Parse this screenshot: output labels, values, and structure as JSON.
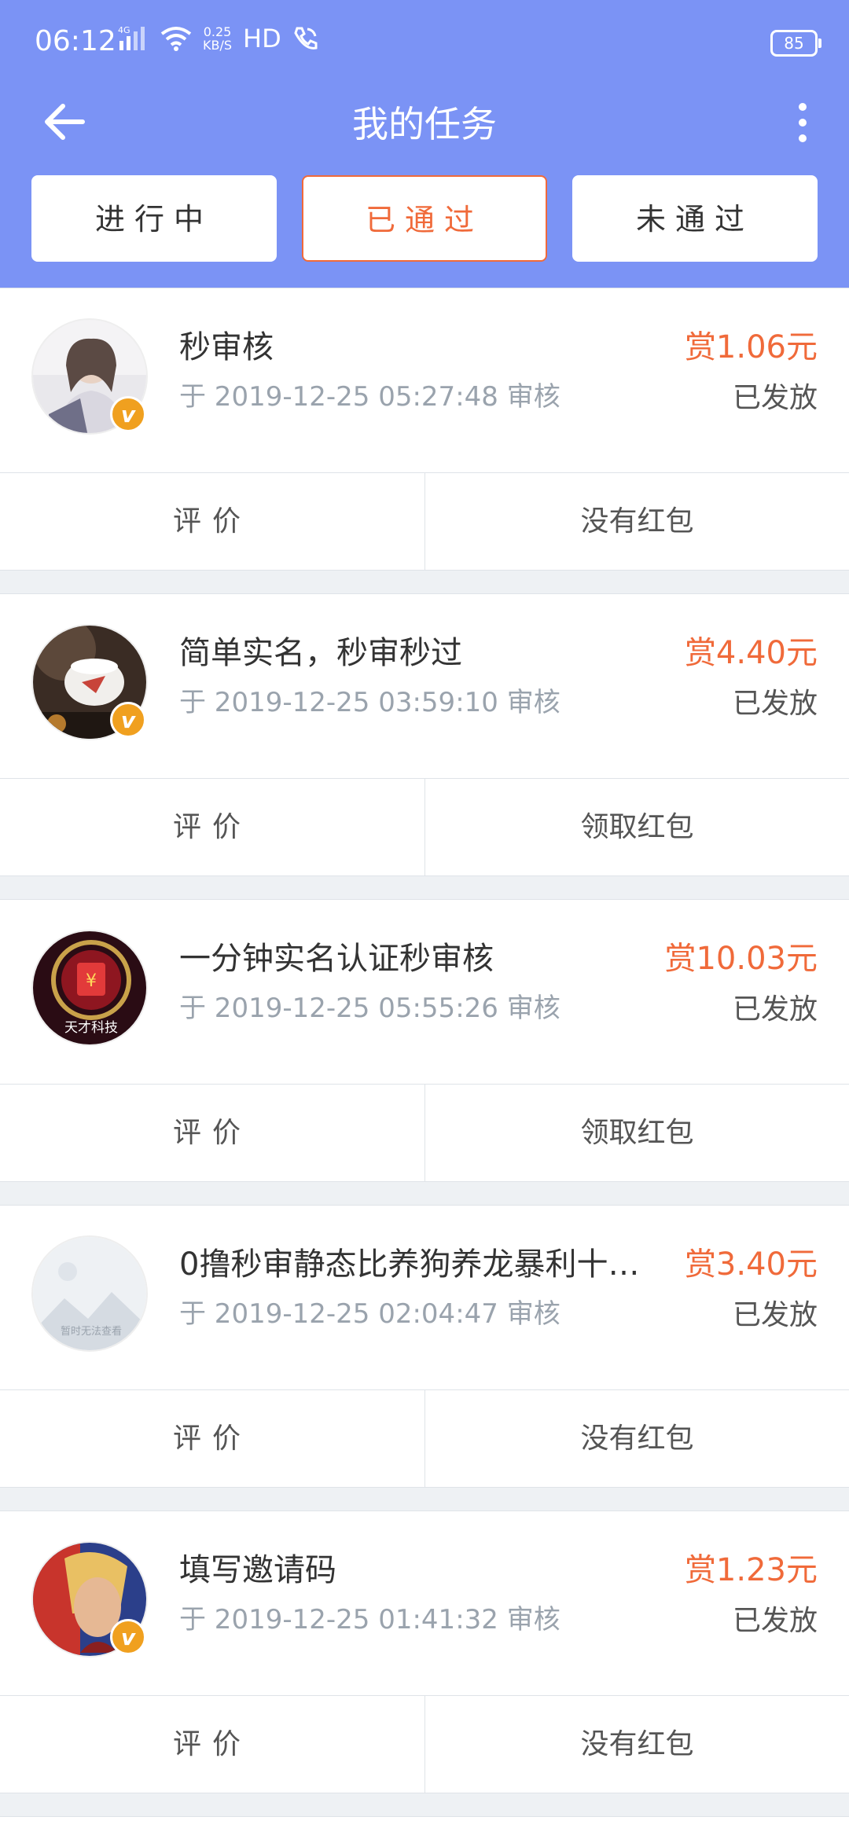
{
  "status_bar": {
    "time": "06:12",
    "net_speed_top": "0.25",
    "net_speed_bottom": "KB/S",
    "hd_label": "HD",
    "battery": "85"
  },
  "header": {
    "title": "我的任务",
    "back_icon": "arrow-left-icon",
    "menu_icon": "more-vertical-icon"
  },
  "tabs": [
    {
      "label": "进行中",
      "active": false
    },
    {
      "label": "已通过",
      "active": true
    },
    {
      "label": "未通过",
      "active": false
    }
  ],
  "colors": {
    "header_bg": "#7b93f5",
    "accent": "#f06a3a",
    "badge": "#f0a01f"
  },
  "tasks": [
    {
      "name": "秒审核",
      "time": "于 2019-12-25 05:27:48 审核",
      "reward": "赏1.06元",
      "status": "已发放",
      "rate_label": "评价",
      "packet_label": "没有红包",
      "verified": true
    },
    {
      "name": "简单实名，秒审秒过",
      "time": "于 2019-12-25 03:59:10 审核",
      "reward": "赏4.40元",
      "status": "已发放",
      "rate_label": "评价",
      "packet_label": "领取红包",
      "verified": true
    },
    {
      "name": "一分钟实名认证秒审核",
      "time": "于 2019-12-25 05:55:26 审核",
      "reward": "赏10.03元",
      "status": "已发放",
      "rate_label": "评价",
      "packet_label": "领取红包",
      "verified": false,
      "avatar_text": "天才科技"
    },
    {
      "name": "0撸秒审静态比养狗养龙暴利十…",
      "time": "于 2019-12-25 02:04:47 审核",
      "reward": "赏3.40元",
      "status": "已发放",
      "rate_label": "评价",
      "packet_label": "没有红包",
      "verified": false,
      "avatar_text": "暂时无法查看"
    },
    {
      "name": "填写邀请码",
      "time": "于 2019-12-25 01:41:32 审核",
      "reward": "赏1.23元",
      "status": "已发放",
      "rate_label": "评价",
      "packet_label": "没有红包",
      "verified": true
    }
  ]
}
